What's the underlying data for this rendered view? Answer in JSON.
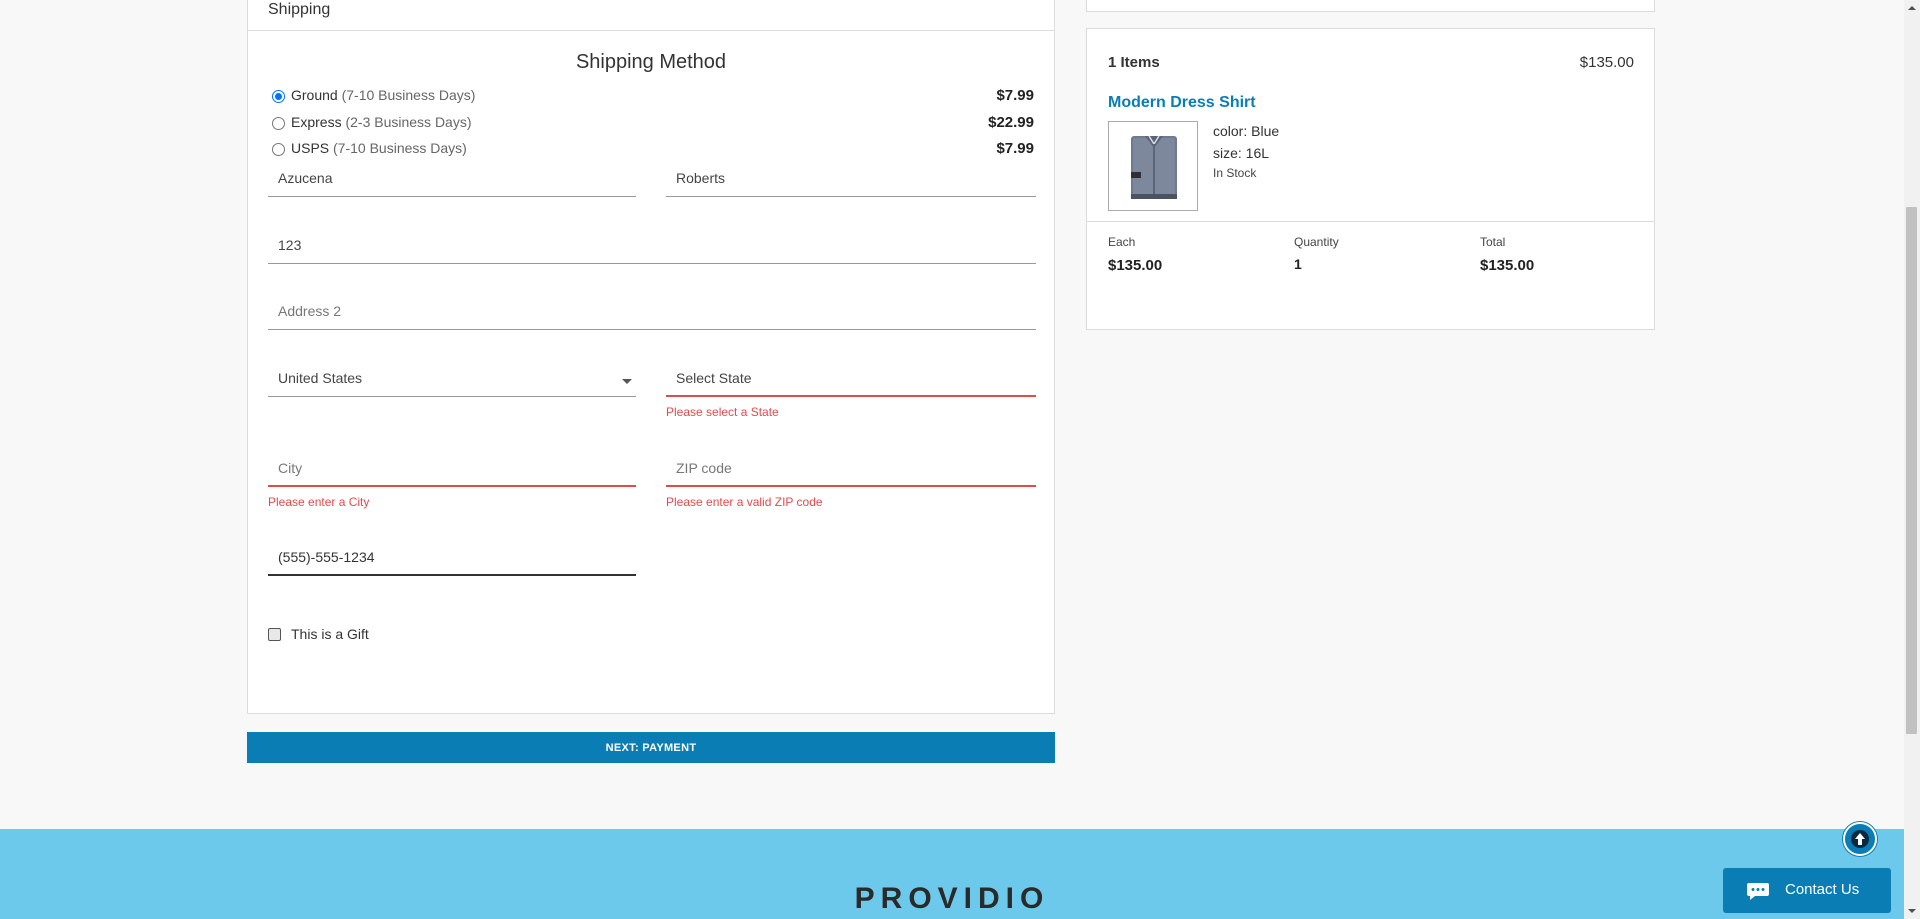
{
  "shipping": {
    "header": "Shipping",
    "section_title": "Shipping Method",
    "methods": [
      {
        "name": "Ground",
        "days": "(7-10 Business Days)",
        "price": "$7.99",
        "selected": true
      },
      {
        "name": "Express",
        "days": "(2-3 Business Days)",
        "price": "$22.99",
        "selected": false
      },
      {
        "name": "USPS",
        "days": "(7-10 Business Days)",
        "price": "$7.99",
        "selected": false
      }
    ],
    "first_name": "Azucena",
    "last_name": "Roberts",
    "address1": "123",
    "address2_placeholder": "Address 2",
    "country": "United States",
    "state_placeholder": "Select State",
    "state_error": "Please select a State",
    "city_placeholder": "City",
    "city_error": "Please enter a City",
    "zip_placeholder": "ZIP code",
    "zip_error": "Please enter a valid ZIP code",
    "phone": "(555)-555-1234",
    "gift_label": "This is a Gift",
    "next_button": "NEXT: PAYMENT"
  },
  "cart": {
    "items_count": "1 Items",
    "subtotal": "$135.00",
    "product_name": "Modern Dress Shirt",
    "color": "color: Blue",
    "size": "size: 16L",
    "stock": "In Stock",
    "each_label": "Each",
    "each_value": "$135.00",
    "qty_label": "Quantity",
    "qty_value": "1",
    "total_label": "Total",
    "total_value": "$135.00"
  },
  "footer": {
    "brand": "PROVIDIO",
    "contact_label": "Contact Us"
  },
  "colors": {
    "accent": "#0b7db5",
    "error": "#e04b4b",
    "footer_bg": "#6cc9ec"
  }
}
